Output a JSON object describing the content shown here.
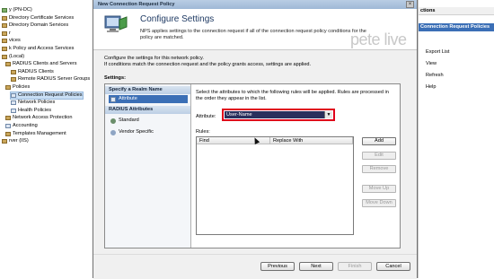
{
  "background": {
    "tree": [
      {
        "label": "y (PN-DC)",
        "icon": "server-icon"
      },
      {
        "label": "Directory Certificate Services",
        "icon": "folder-icon"
      },
      {
        "label": "Directory Domain Services",
        "icon": "folder-icon"
      },
      {
        "label": "r",
        "icon": "folder-icon"
      },
      {
        "label": "vices",
        "icon": "folder-icon"
      },
      {
        "label": "k Policy and Access Services",
        "icon": "folder-icon"
      },
      {
        "label": "(Local)",
        "icon": "folder-icon"
      },
      {
        "label": "RADIUS Clients and Servers",
        "icon": "folder-icon"
      },
      {
        "label": "RADIUS Clients",
        "icon": "folder-icon"
      },
      {
        "label": "Remote RADIUS Server Groups",
        "icon": "folder-icon"
      },
      {
        "label": "Policies",
        "icon": "folder-icon"
      },
      {
        "label": "Connection Request Policies",
        "icon": "page-icon"
      },
      {
        "label": "Network Policies",
        "icon": "page-icon"
      },
      {
        "label": "Health Policies",
        "icon": "page-icon"
      },
      {
        "label": "Network Access Protection",
        "icon": "folder-icon"
      },
      {
        "label": "Accounting",
        "icon": "page-icon"
      },
      {
        "label": "Templates Management",
        "icon": "folder-icon"
      },
      {
        "label": "rver (IIS)",
        "icon": "folder-icon"
      }
    ],
    "actions_title": "ctions",
    "actions_subtitle": "Connection Request Policies",
    "actions": [
      "Export List",
      "View",
      "Refresh",
      "Help"
    ],
    "watermark": "pete   live"
  },
  "dialog": {
    "title": "New Connection Request Policy",
    "close_glyph": "×",
    "page_title": "Configure Settings",
    "page_description": "NPS applies settings to the connection request if all of the connection request policy conditions for the policy are matched.",
    "intro": "Configure the settings for this network policy.\nIf conditions match the connection request and the policy grants access, settings are applied.",
    "settings_label": "Settings:",
    "nav": {
      "section1": "Specify a Realm Name",
      "item_attribute": "Attribute",
      "section2": "RADIUS Attributes",
      "item_standard": "Standard",
      "item_vendor": "Vendor Specific"
    },
    "pane": {
      "description": "Select the attributes to which the following rules will be applied. Rules are processed in the order they appear in the list.",
      "attribute_label": "Attribute:",
      "attribute_value": "User-Name",
      "rules_label": "Rules:",
      "columns": [
        "Find",
        "Replace With"
      ],
      "buttons": {
        "add": "Add",
        "edit": "Edit",
        "remove": "Remove",
        "move_up": "Move Up",
        "move_down": "Move Down"
      }
    },
    "footer": {
      "previous": "Previous",
      "next": "Next",
      "finish": "Finish",
      "cancel": "Cancel"
    }
  }
}
